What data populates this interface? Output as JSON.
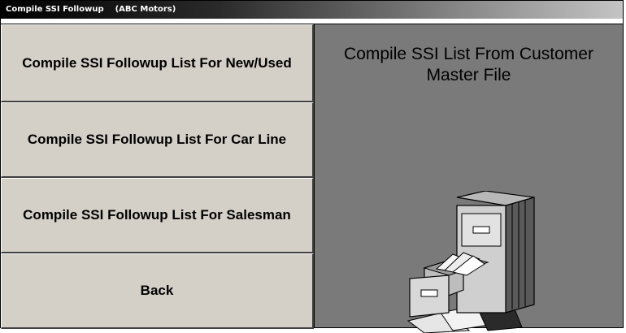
{
  "window": {
    "title": "Compile SSI Followup",
    "app_name": "(ABC Motors)"
  },
  "menu": {
    "items": [
      {
        "label": "Compile SSI Followup List For New/Used"
      },
      {
        "label": "Compile SSI Followup List For Car Line"
      },
      {
        "label": "Compile SSI Followup List For Salesman"
      },
      {
        "label": "Back"
      }
    ]
  },
  "info": {
    "title": "Compile SSI List From Customer Master File",
    "illustration_icon": "file-cabinet-icon"
  },
  "colors": {
    "panel_bg": "#d4d0c8",
    "info_bg": "#7a7a7a",
    "titlebar": "#000000"
  }
}
